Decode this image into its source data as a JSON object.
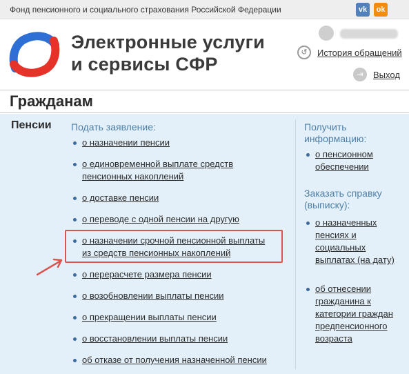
{
  "topbar": {
    "org_name": "Фонд пенсионного и социального страхования Российской Федерации",
    "social": [
      {
        "name": "vk",
        "label": "vk",
        "color": "#5181b8"
      },
      {
        "name": "odnoklassniki",
        "label": "ok",
        "color": "#f28c0f"
      }
    ]
  },
  "header": {
    "title_line1": "Электронные услуги",
    "title_line2": "и сервисы СФР",
    "history_link": "История обращений",
    "logout_link": "Выход",
    "brand_colors": {
      "blue": "#2e6fd6",
      "red": "#e5332a"
    }
  },
  "section": {
    "title": "Гражданам"
  },
  "category": {
    "title": "Пенсии"
  },
  "apply": {
    "heading": "Подать заявление:",
    "items": [
      {
        "line1": "о назначении пенсии",
        "line2": ""
      },
      {
        "line1": "о единовременной выплате средств",
        "line2": "пенсионных накоплений"
      },
      {
        "line1": "о доставке пенсии",
        "line2": ""
      },
      {
        "line1": "о переводе с одной пенсии на другую",
        "line2": ""
      },
      {
        "line1": "о назначении срочной пенсионной выплаты",
        "line2": "из средств пенсионных накоплений"
      },
      {
        "line1": "о перерасчете размера пенсии",
        "line2": ""
      },
      {
        "line1": "о возобновлении выплаты пенсии",
        "line2": ""
      },
      {
        "line1": "о прекращении выплаты пенсии",
        "line2": ""
      },
      {
        "line1": "о восстановлении выплаты пенсии",
        "line2": ""
      },
      {
        "line1": "об отказе от получения назначенной пенсии",
        "line2": ""
      }
    ]
  },
  "info": {
    "heading_line1": "Получить",
    "heading_line2": "информацию:",
    "items": [
      {
        "line1": "о пенсионном",
        "line2": "обеспечении"
      }
    ]
  },
  "certificate": {
    "heading_line1": "Заказать справку",
    "heading_line2": "(выписку):",
    "items": [
      {
        "lines": [
          "о назначенных",
          "пенсиях и",
          "социальных",
          "выплатах (на дату)"
        ]
      },
      {
        "lines": [
          "об отнесении",
          "гражданина к",
          "категории граждан",
          "предпенсионного",
          "возраста"
        ]
      }
    ]
  },
  "annotation": {
    "highlight_color": "#d9534f",
    "arrow_color": "#d9534f"
  }
}
